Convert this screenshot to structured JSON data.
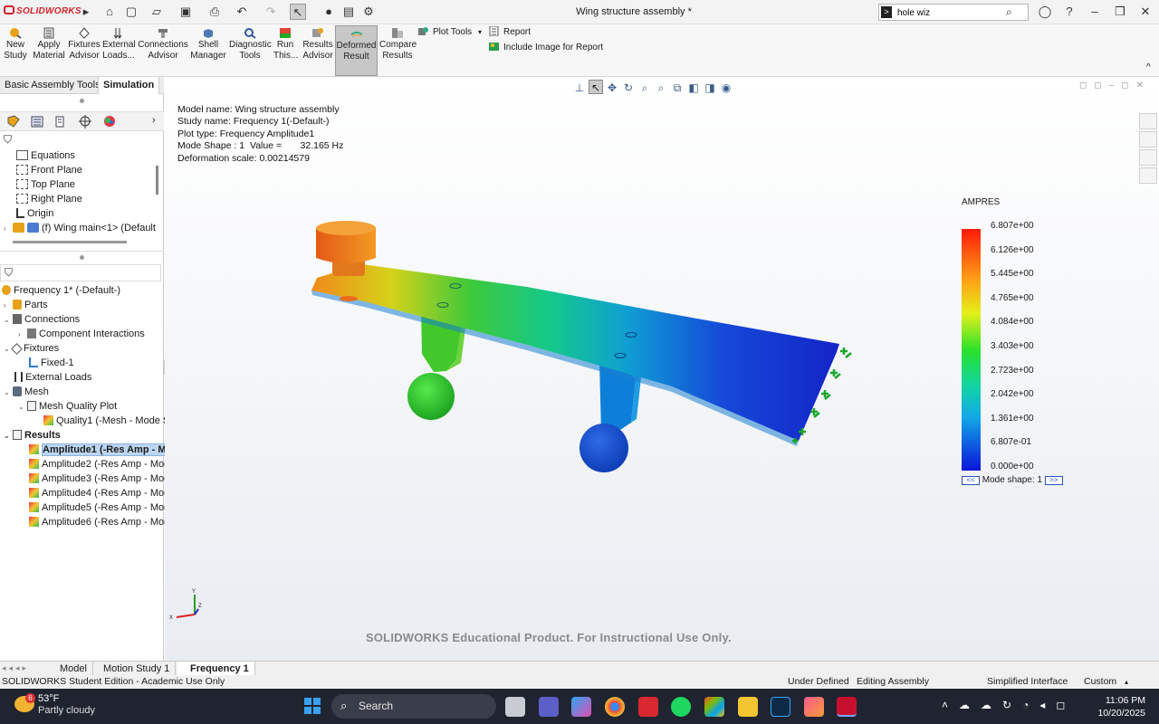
{
  "app": {
    "logo_text": "SOLIDWORKS",
    "document_title": "Wing structure assembly *"
  },
  "search": {
    "value": "hole wiz"
  },
  "ribbon": {
    "new_study": "New\nStudy",
    "apply_material": "Apply\nMaterial",
    "fixtures_advisor": "Fixtures\nAdvisor",
    "external_loads": "External\nLoads...",
    "connections_advisor": "Connections\nAdvisor",
    "shell_manager": "Shell\nManager",
    "diagnostic_tools": "Diagnostic\nTools",
    "run_this": "Run\nThis...",
    "results_advisor": "Results\nAdvisor",
    "deformed_result": "Deformed\nResult",
    "compare_results": "Compare\nResults",
    "plot_tools": "Plot Tools",
    "report": "Report",
    "include_image": "Include Image for Report"
  },
  "left_tabs": {
    "basic": "Basic Assembly Tools",
    "simulation": "Simulation"
  },
  "feature_tree": [
    {
      "label": "Equations",
      "icon": "equations-icon"
    },
    {
      "label": "Front Plane",
      "icon": "plane-icon"
    },
    {
      "label": "Top Plane",
      "icon": "plane-icon"
    },
    {
      "label": "Right Plane",
      "icon": "plane-icon"
    },
    {
      "label": "Origin",
      "icon": "origin-icon"
    },
    {
      "label": "(f) Wing main<1> (Default",
      "icon": "part-icon"
    }
  ],
  "study_tree": {
    "root": "Frequency 1* (-Default-)",
    "parts": "Parts",
    "connections": "Connections",
    "component_interactions": "Component Interactions",
    "fixtures": "Fixtures",
    "fixed1": "Fixed-1",
    "external_loads": "External Loads",
    "mesh": "Mesh",
    "mesh_quality_plot": "Mesh Quality Plot",
    "quality1": "Quality1 (-Mesh - Mode Sh",
    "results": "Results",
    "amplitudes": [
      "Amplitude1 (-Res Amp - Mo",
      "Amplitude2 (-Res Amp - Mod",
      "Amplitude3 (-Res Amp - Mod",
      "Amplitude4 (-Res Amp - Mod",
      "Amplitude5 (-Res Amp - Mod",
      "Amplitude6 (-Res Amp - Mod"
    ]
  },
  "plot_info": {
    "model_name": "Model name: Wing structure assembly",
    "study_name": "Study name: Frequency 1(-Default-)",
    "plot_type": "Plot type: Frequency Amplitude1",
    "mode_shape": "Mode Shape : 1  Value =       32.165 Hz",
    "deformation_scale": "Deformation scale: 0.00214579"
  },
  "legend": {
    "title": "AMPRES",
    "ticks": [
      "6.807e+00",
      "6.126e+00",
      "5.445e+00",
      "4.765e+00",
      "4.084e+00",
      "3.403e+00",
      "2.723e+00",
      "2.042e+00",
      "1.361e+00",
      "6.807e-01",
      "0.000e+00"
    ],
    "mode_shape_label": "Mode shape: 1",
    "prev": "<<",
    "next": ">>"
  },
  "triad": {
    "x": "X",
    "y": "Y",
    "z": "Z"
  },
  "watermark": "SOLIDWORKS Educational Product. For Instructional Use Only.",
  "bottom_tabs": [
    "Model",
    "Motion Study 1",
    "Frequency 1"
  ],
  "status": {
    "edition": "SOLIDWORKS Student Edition - Academic Use Only",
    "defined": "Under Defined",
    "editing": "Editing Assembly",
    "interface": "Simplified Interface",
    "custom": "Custom"
  },
  "taskbar": {
    "weather_badge": "6",
    "temperature": "53°F",
    "condition": "Partly cloudy",
    "search_label": "Search",
    "time": "11:06 PM",
    "date": "10/20/2025"
  }
}
